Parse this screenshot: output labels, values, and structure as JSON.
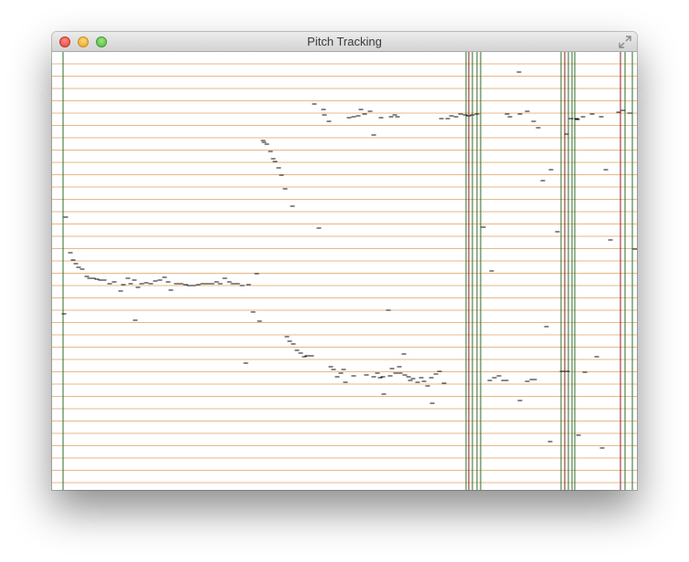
{
  "window": {
    "title": "Pitch Tracking",
    "controls": [
      "close-icon",
      "minimize-icon",
      "zoom-icon"
    ],
    "fullscreen_icon": "fullscreen-icon"
  },
  "colors": {
    "pitch_line": "#e6b888",
    "marker_line": "#2d6b2a",
    "onset_line": "#8a1c1c",
    "pitch_point": "#111111"
  }
}
